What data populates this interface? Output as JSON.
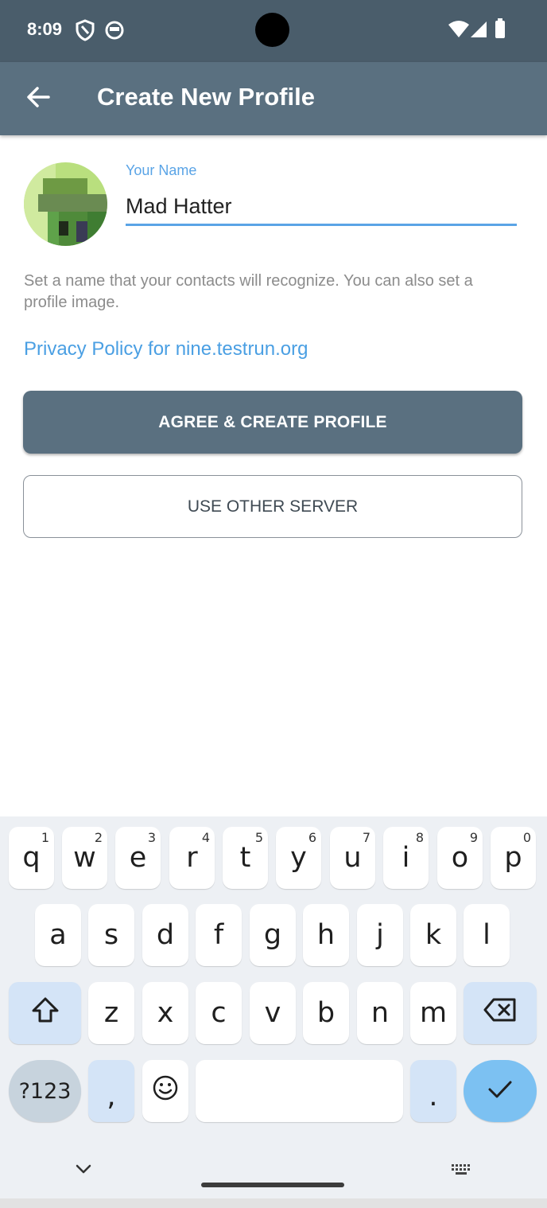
{
  "status_bar": {
    "time": "8:09",
    "icons": [
      "vpn-shield-icon",
      "app-notification-icon",
      "wifi-icon",
      "signal-icon",
      "battery-icon"
    ]
  },
  "app_bar": {
    "title": "Create New Profile",
    "back_icon": "arrow-left-icon"
  },
  "profile": {
    "avatar_icon": "pixel-avatar-icon",
    "name_label": "Your Name",
    "name_value": "Mad Hatter",
    "help_text": "Set a name that your contacts will recognize. You can also set a profile image.",
    "privacy_link": "Privacy Policy for nine.testrun.org",
    "agree_button": "AGREE & CREATE PROFILE",
    "other_server_button": "USE OTHER SERVER"
  },
  "colors": {
    "app_bar": "#5a7080",
    "status_bar": "#4a5d6b",
    "accent": "#5aa4e6",
    "link": "#4a9fe3"
  },
  "keyboard": {
    "row1": [
      {
        "key": "q",
        "hint": "1"
      },
      {
        "key": "w",
        "hint": "2"
      },
      {
        "key": "e",
        "hint": "3"
      },
      {
        "key": "r",
        "hint": "4"
      },
      {
        "key": "t",
        "hint": "5"
      },
      {
        "key": "y",
        "hint": "6"
      },
      {
        "key": "u",
        "hint": "7"
      },
      {
        "key": "i",
        "hint": "8"
      },
      {
        "key": "o",
        "hint": "9"
      },
      {
        "key": "p",
        "hint": "0"
      }
    ],
    "row2": [
      "a",
      "s",
      "d",
      "f",
      "g",
      "h",
      "j",
      "k",
      "l"
    ],
    "row3": [
      "z",
      "x",
      "c",
      "v",
      "b",
      "n",
      "m"
    ],
    "symbols_key": "?123",
    "comma_key": ",",
    "period_key": ".",
    "shift_icon": "shift-icon",
    "backspace_icon": "backspace-icon",
    "emoji_icon": "emoji-icon",
    "enter_icon": "checkmark-icon",
    "hide_icon": "chevron-down-icon",
    "switch_icon": "keyboard-icon"
  }
}
